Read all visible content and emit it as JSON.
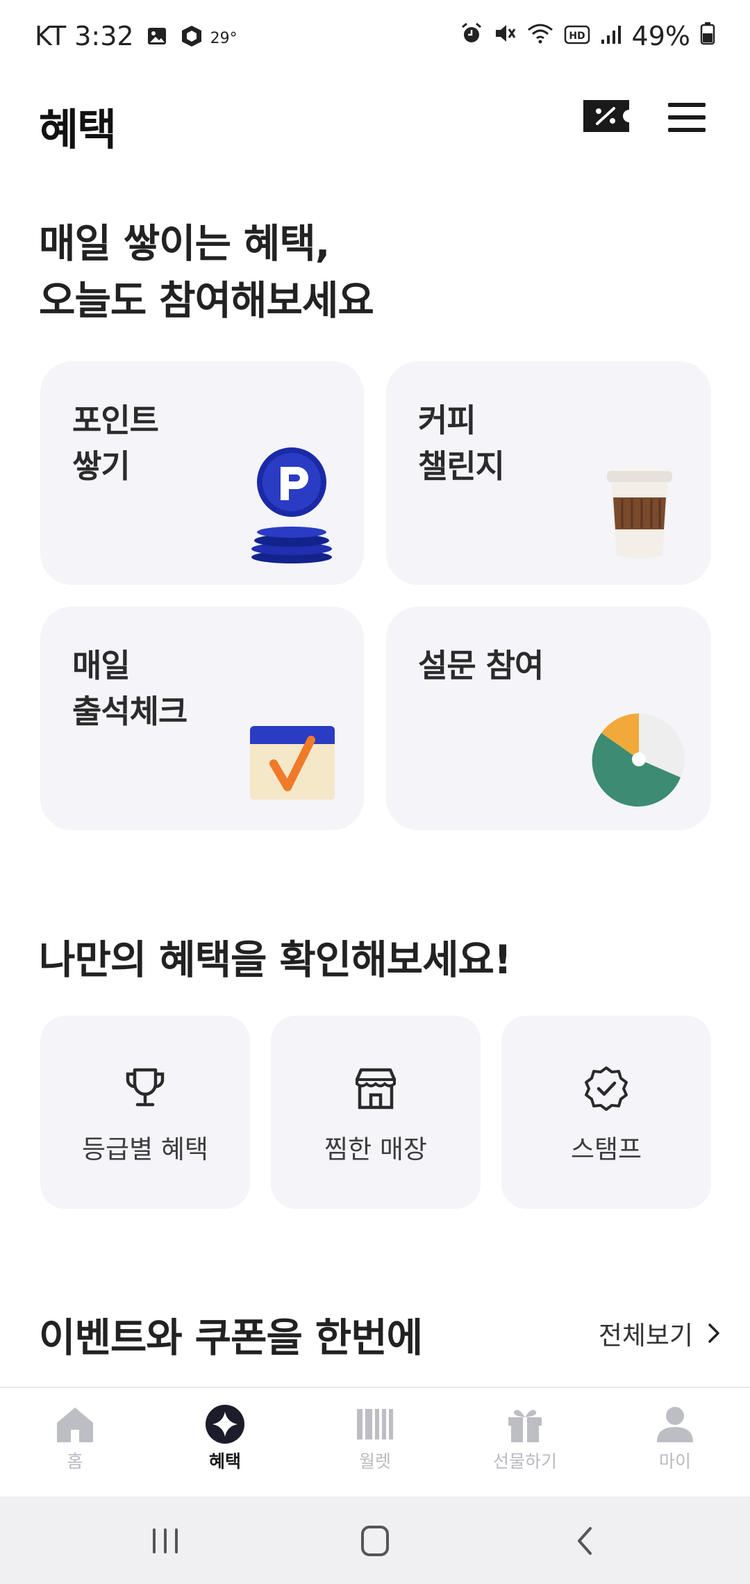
{
  "status_bar": {
    "carrier_time": "KT 3:32",
    "temperature": "29°",
    "battery": "49%"
  },
  "header": {
    "title": "혜택"
  },
  "section_daily": {
    "title_line1": "매일 쌓이는 혜택,",
    "title_line2": "오늘도 참여해보세요",
    "cards": [
      {
        "label": "포인트\n쌓기"
      },
      {
        "label": "커피\n챌린지"
      },
      {
        "label": "매일\n출석체크"
      },
      {
        "label": "설문 참여"
      }
    ]
  },
  "section_my": {
    "title": "나만의 혜택을 확인해보세요!",
    "tiles": [
      {
        "label": "등급별 혜택"
      },
      {
        "label": "찜한 매장"
      },
      {
        "label": "스탬프"
      }
    ]
  },
  "section_events": {
    "title": "이벤트와 쿠폰을 한번에",
    "see_all": "전체보기"
  },
  "bottom_nav": {
    "items": [
      {
        "label": "홈"
      },
      {
        "label": "혜택"
      },
      {
        "label": "월렛"
      },
      {
        "label": "선물하기"
      },
      {
        "label": "마이"
      }
    ],
    "active_index": 1
  },
  "colors": {
    "card_bg": "#f4f4f9",
    "point_blue": "#1f2fb0",
    "coffee_brown": "#8a5a3a",
    "survey_green": "#3e8b74",
    "survey_orange": "#f1a93a",
    "check_orange": "#ef7a2a"
  }
}
